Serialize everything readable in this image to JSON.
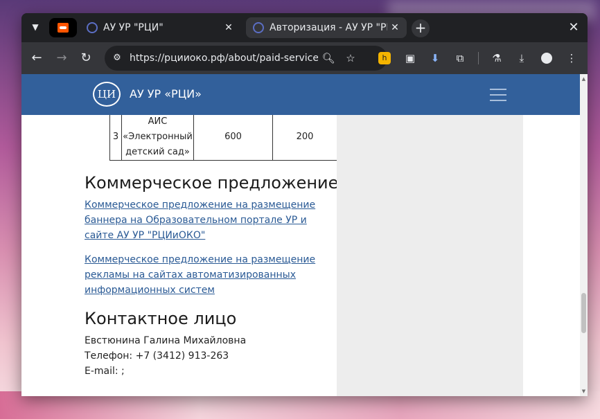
{
  "browser": {
    "tabs": [
      {
        "title": "АУ УР \"РЦИ\"",
        "active": false
      },
      {
        "title": "Авторизация - АУ УР \"РЦИ\"",
        "active": true
      }
    ],
    "url": "https://рцииоко.рф/about/paid-services...",
    "icons": {
      "tab_search": "chevron-down-icon",
      "pinned_tab": "soundcloud-icon",
      "new_tab": "plus-icon",
      "close_window": "close-icon",
      "back": "arrow-left-icon",
      "forward": "arrow-right-icon",
      "reload": "reload-icon",
      "site_info": "tune-icon",
      "zoom": "magnifier-icon",
      "bookmark": "star-icon",
      "extensions": [
        "extension-honey-icon",
        "picture-in-picture-icon",
        "download-arrow-icon",
        "puzzle-icon"
      ],
      "labs": "flask-icon",
      "downloads": "download-icon",
      "profile": "profile-icon",
      "menu": "kebab-menu-icon"
    }
  },
  "site": {
    "logo_text": "ЦИ",
    "name": "АУ УР «РЦИ»"
  },
  "table_row": {
    "number": "3",
    "name": "АИС «Электронный детский сад»",
    "price_1": "600",
    "price_2": "200"
  },
  "commercial": {
    "heading": "Коммерческое предложение",
    "links": [
      "Коммерческое предложение на размещение баннера на Образовательном портале УР и сайте АУ УР \"РЦИиОКО\"",
      "Коммерческое предложение на размещение рекламы на сайтах автоматизированных информационных систем"
    ]
  },
  "contact": {
    "heading": "Контактное лицо",
    "name": "Евстюнина Галина Михайловна",
    "phone": "Телефон: +7 (3412) 913-263",
    "email": "E-mail: ;"
  },
  "colors": {
    "header_blue": "#32609b",
    "link_blue": "#2a5a95",
    "browser_dark": "#202124",
    "toolbar": "#35363a"
  }
}
